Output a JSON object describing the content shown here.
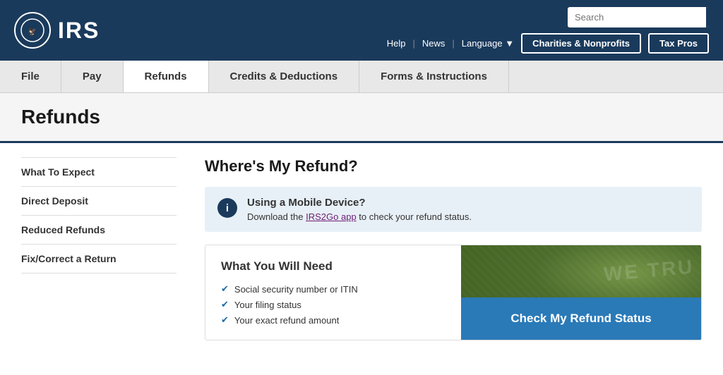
{
  "header": {
    "logo_text": "IRS",
    "search_placeholder": "Search",
    "links": {
      "help": "Help",
      "news": "News",
      "language": "Language"
    },
    "buttons": {
      "charities": "Charities & Nonprofits",
      "tax_pros": "Tax Pros"
    }
  },
  "nav": {
    "items": [
      {
        "label": "File",
        "active": false
      },
      {
        "label": "Pay",
        "active": false
      },
      {
        "label": "Refunds",
        "active": true
      },
      {
        "label": "Credits & Deductions",
        "active": false
      },
      {
        "label": "Forms & Instructions",
        "active": false
      }
    ]
  },
  "page_title": "Refunds",
  "sidebar": {
    "items": [
      {
        "label": "What To Expect"
      },
      {
        "label": "Direct Deposit"
      },
      {
        "label": "Reduced Refunds"
      },
      {
        "label": "Fix/Correct a Return"
      }
    ]
  },
  "main": {
    "heading": "Where's My Refund?",
    "info_box": {
      "icon": "i",
      "title": "Using a Mobile Device?",
      "desc_prefix": "Download the ",
      "link_text": "IRS2Go app",
      "desc_suffix": " to check your refund status."
    },
    "card": {
      "title": "What You Will Need",
      "items": [
        "Social security number or ITIN",
        "Your filing status",
        "Your exact refund amount"
      ],
      "bg_text": "WE TRU",
      "button_label": "Check My Refund Status"
    }
  }
}
